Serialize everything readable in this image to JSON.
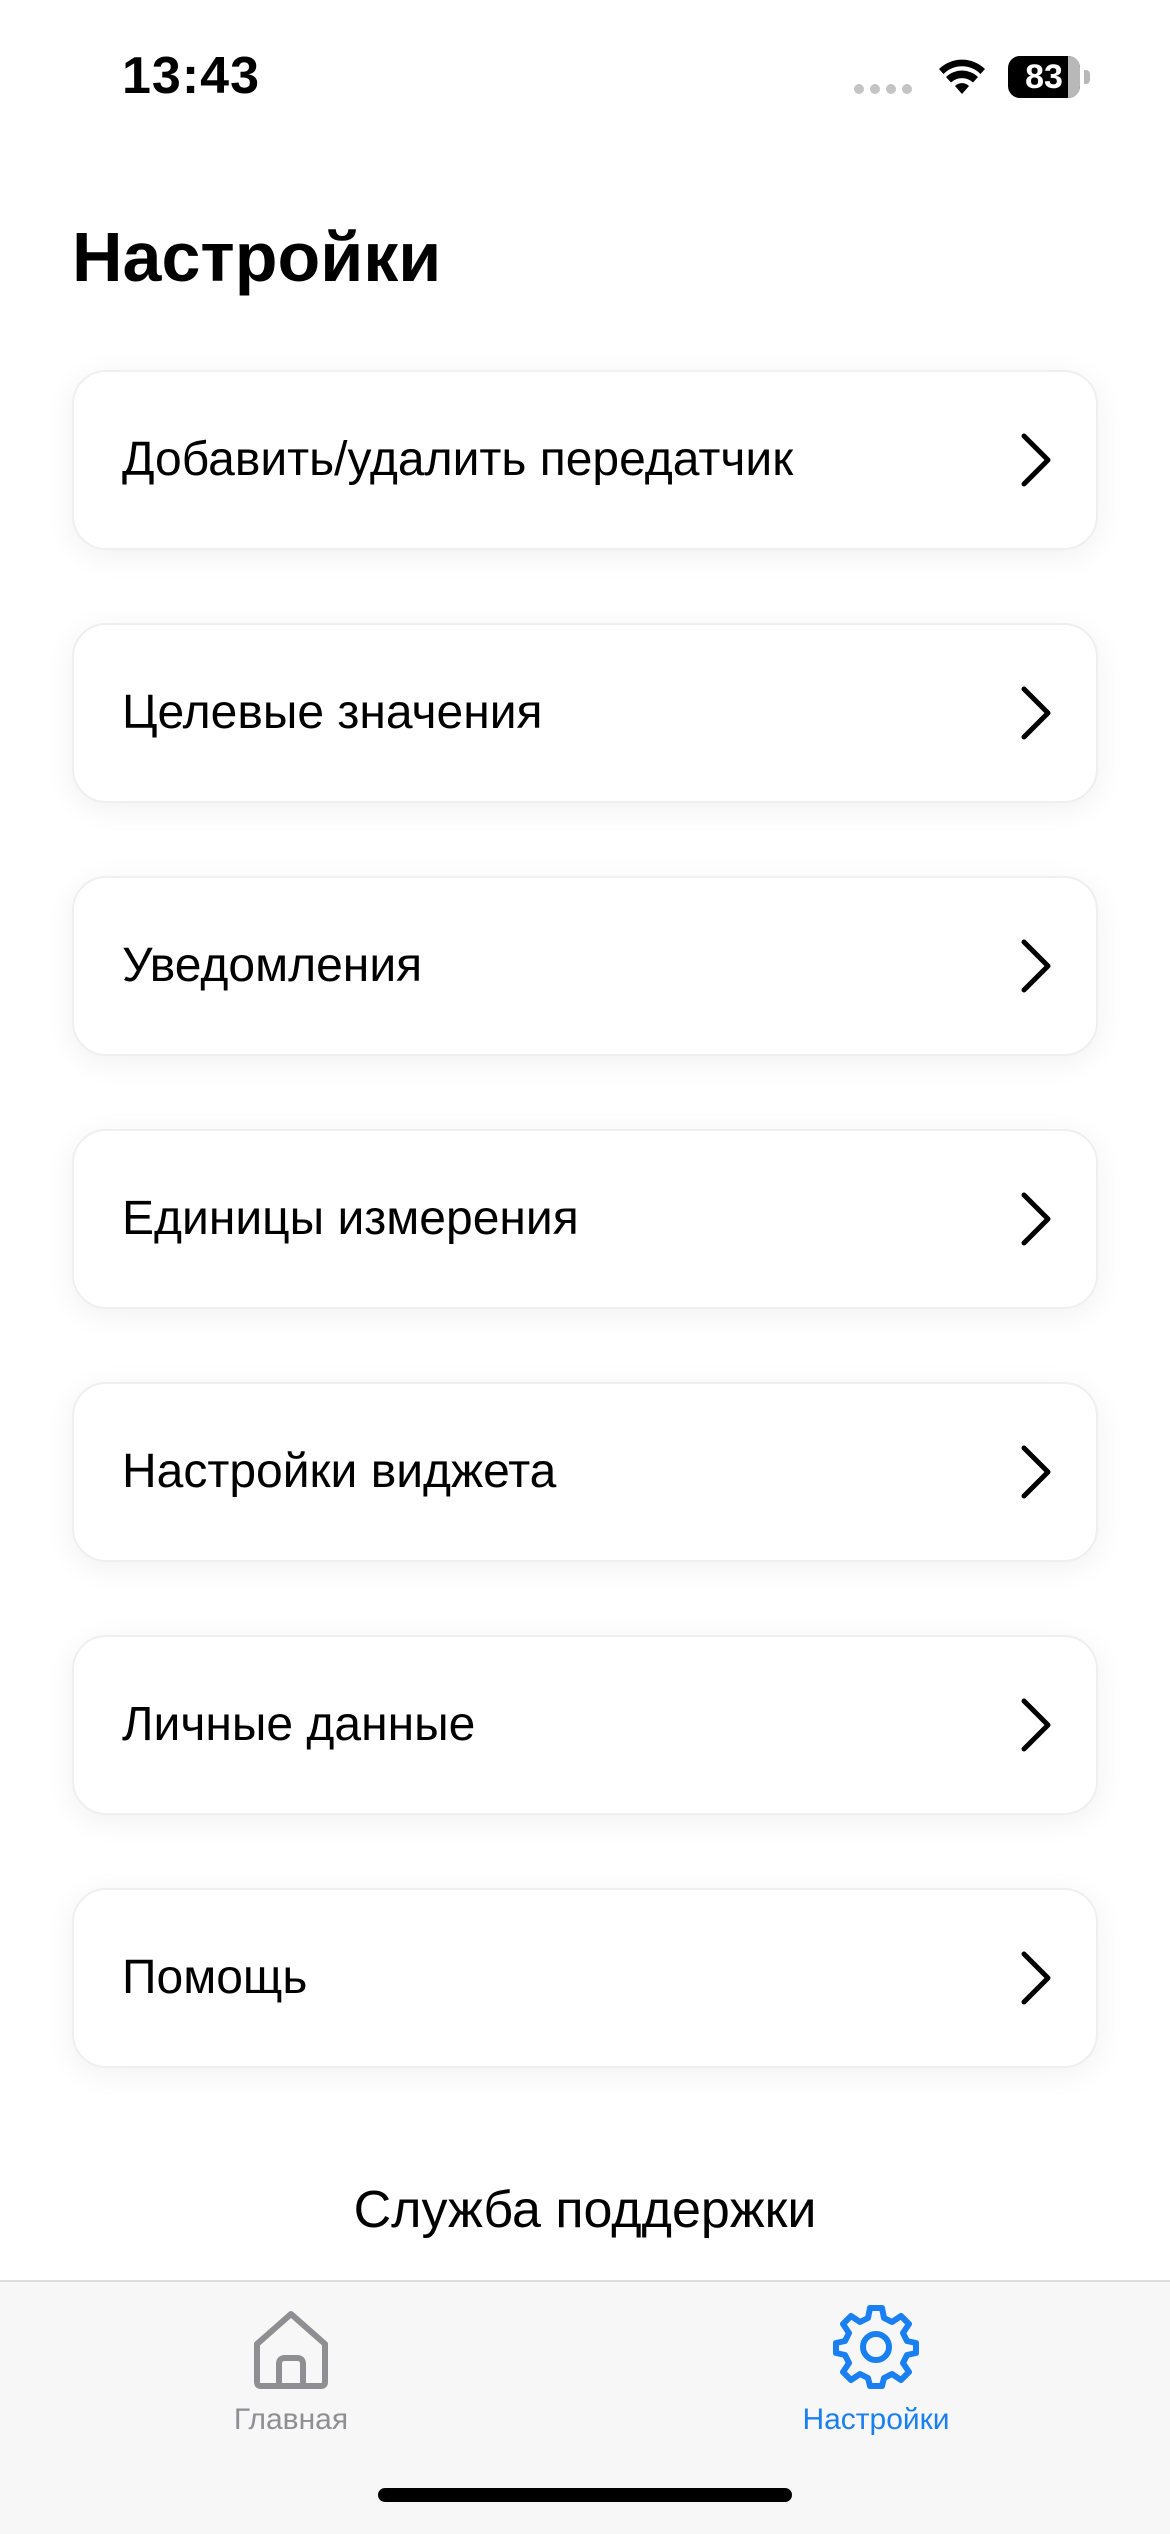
{
  "status_bar": {
    "time": "13:43",
    "battery_percent": "83",
    "battery_level": 0.83
  },
  "title": "Настройки",
  "menu": [
    {
      "label": "Добавить/удалить передатчик",
      "icon": "chevron-right-icon"
    },
    {
      "label": "Целевые значения",
      "icon": "chevron-right-icon"
    },
    {
      "label": "Уведомления",
      "icon": "chevron-right-icon"
    },
    {
      "label": "Единицы измерения",
      "icon": "chevron-right-icon"
    },
    {
      "label": "Настройки виджета",
      "icon": "chevron-right-icon"
    },
    {
      "label": "Личные данные",
      "icon": "chevron-right-icon"
    },
    {
      "label": "Помощь",
      "icon": "chevron-right-icon"
    }
  ],
  "support_label": "Служба поддержки",
  "tabbar": {
    "home": {
      "label": "Главная",
      "icon": "home-icon",
      "active": false
    },
    "settings": {
      "label": "Настройки",
      "icon": "gear-icon",
      "active": true
    }
  },
  "colors": {
    "accent": "#1a7ff0",
    "inactive": "#8e8e93"
  }
}
